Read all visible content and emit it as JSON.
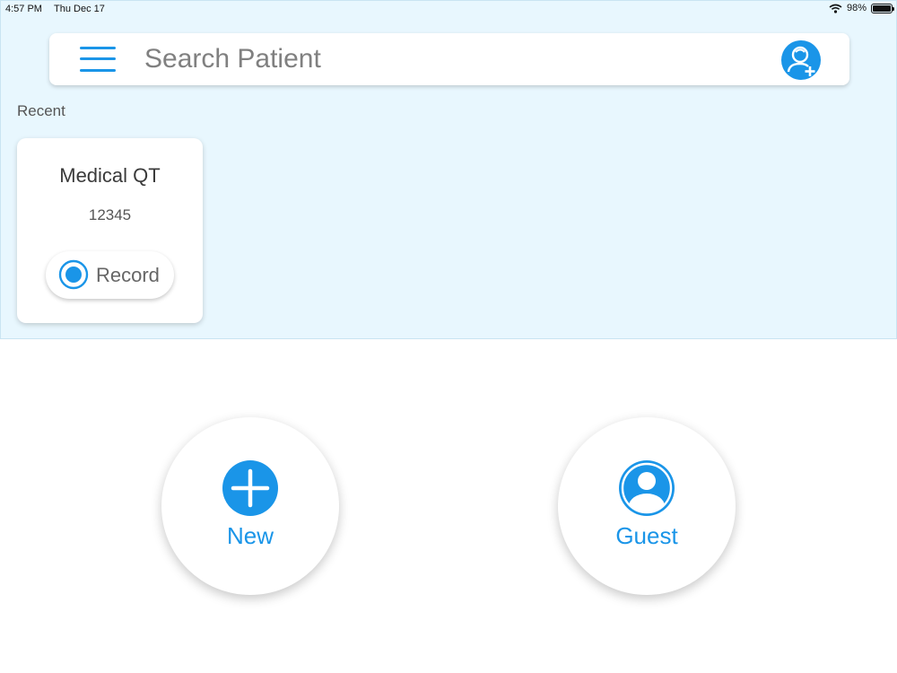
{
  "status_bar": {
    "time": "4:57 PM",
    "date": "Thu Dec 17",
    "battery": "98%",
    "battery_level": 0.98
  },
  "search": {
    "placeholder": "Search Patient",
    "menu_icon": "hamburger-menu-icon",
    "right_icon": "add-doctor-icon"
  },
  "recent": {
    "label": "Recent",
    "cards": [
      {
        "name": "Medical QT",
        "id": "12345",
        "record_label": "Record"
      }
    ]
  },
  "actions": {
    "new_label": "New",
    "guest_label": "Guest"
  },
  "colors": {
    "accent": "#1a95e8",
    "panel_background": "#e8f7fe"
  }
}
